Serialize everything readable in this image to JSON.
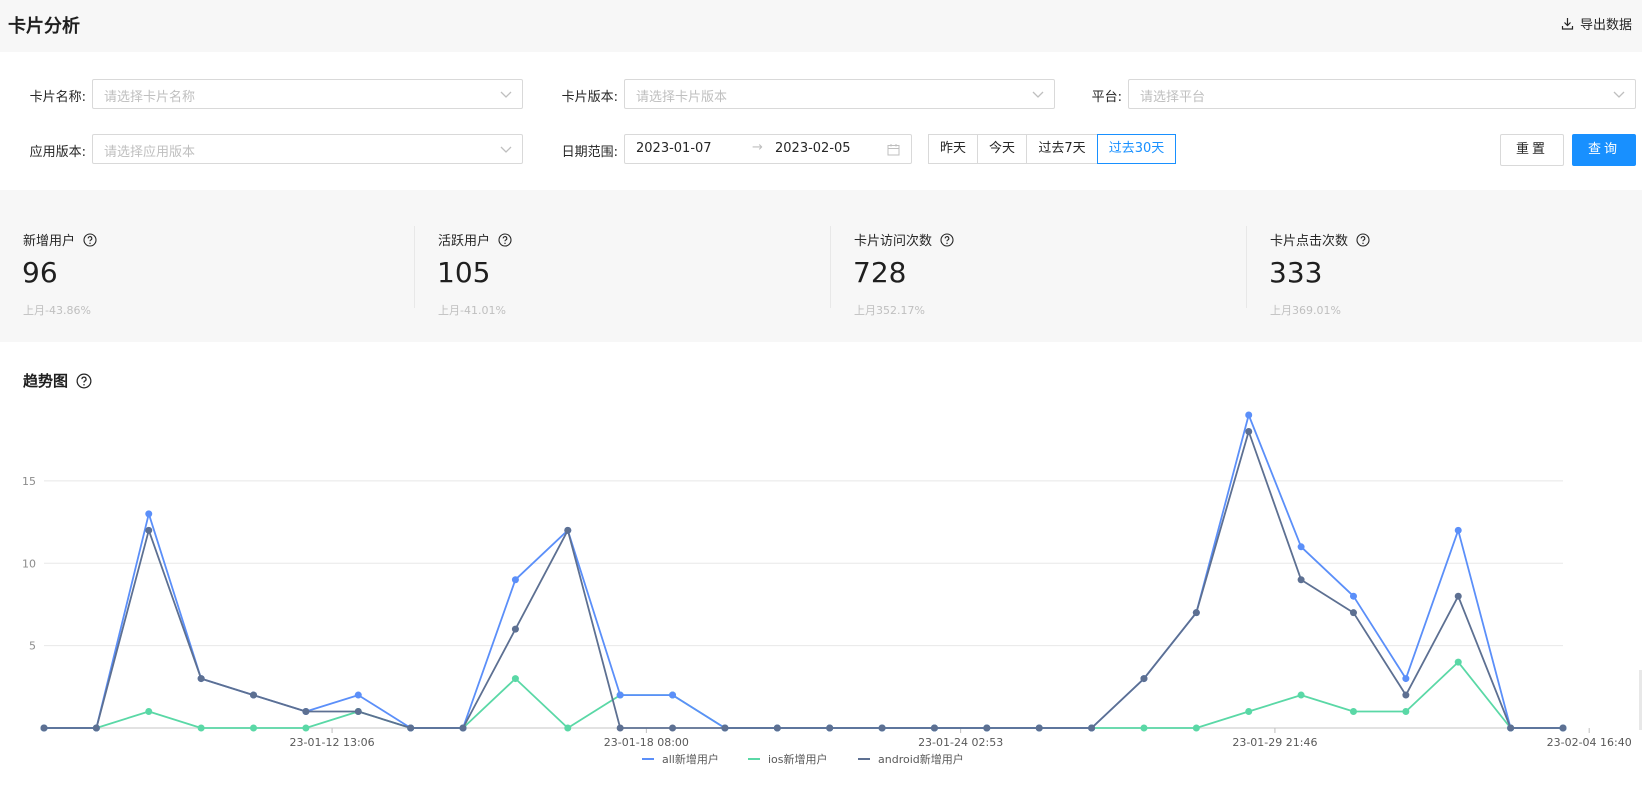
{
  "header": {
    "title": "卡片分析",
    "export_label": "导出数据"
  },
  "filters": {
    "card_name": {
      "label": "卡片名称:",
      "placeholder": "请选择卡片名称"
    },
    "card_version": {
      "label": "卡片版本:",
      "placeholder": "请选择卡片版本"
    },
    "platform": {
      "label": "平台:",
      "placeholder": "请选择平台"
    },
    "app_version": {
      "label": "应用版本:",
      "placeholder": "请选择应用版本"
    },
    "date_range": {
      "label": "日期范围:",
      "start": "2023-01-07",
      "end": "2023-02-05",
      "separator": "→"
    },
    "quick": [
      "昨天",
      "今天",
      "过去7天",
      "过去30天"
    ],
    "quick_active": "过去30天",
    "reset_label": "重置",
    "query_label": "查询"
  },
  "stats": [
    {
      "label": "新增用户",
      "value": "96",
      "sub": "上月-43.86%"
    },
    {
      "label": "活跃用户",
      "value": "105",
      "sub": "上月-41.01%"
    },
    {
      "label": "卡片访问次数",
      "value": "728",
      "sub": "上月352.17%"
    },
    {
      "label": "卡片点击次数",
      "value": "333",
      "sub": "上月369.01%"
    }
  ],
  "trend": {
    "title": "趋势图"
  },
  "colors": {
    "primary": "#1890ff",
    "all": "#5b8ff9",
    "ios": "#5ad8a6",
    "android": "#5d7092"
  },
  "chart_data": {
    "type": "line",
    "title": "",
    "xlabel": "",
    "ylabel": "",
    "ylim": [
      0,
      19
    ],
    "yticks": [
      5,
      10,
      15
    ],
    "grid": true,
    "legend_position": "bottom",
    "x_tick_labels": [
      {
        "index": 6,
        "label": "23-01-12 13:06"
      },
      {
        "index": 12,
        "label": "23-01-18 08:00"
      },
      {
        "index": 18,
        "label": "23-01-24 02:53"
      },
      {
        "index": 24,
        "label": "23-01-29 21:46"
      },
      {
        "index": 30,
        "label": "23-02-04 16:40"
      }
    ],
    "point_count": 30,
    "series": [
      {
        "name": "all新增用户",
        "color": "#5b8ff9",
        "values": [
          0,
          0,
          13,
          3,
          2,
          1,
          2,
          0,
          0,
          9,
          12,
          2,
          2,
          0,
          0,
          0,
          0,
          0,
          0,
          0,
          0,
          3,
          7,
          19,
          11,
          8,
          3,
          12,
          0,
          0
        ]
      },
      {
        "name": "ios新增用户",
        "color": "#5ad8a6",
        "values": [
          0,
          0,
          1,
          0,
          0,
          0,
          1,
          0,
          0,
          3,
          0,
          2,
          2,
          0,
          0,
          0,
          0,
          0,
          0,
          0,
          0,
          0,
          0,
          1,
          2,
          1,
          1,
          4,
          0,
          0
        ]
      },
      {
        "name": "android新增用户",
        "color": "#5d7092",
        "values": [
          0,
          0,
          12,
          3,
          2,
          1,
          1,
          0,
          0,
          6,
          12,
          0,
          0,
          0,
          0,
          0,
          0,
          0,
          0,
          0,
          0,
          3,
          7,
          18,
          9,
          7,
          2,
          8,
          0,
          0
        ]
      }
    ]
  }
}
